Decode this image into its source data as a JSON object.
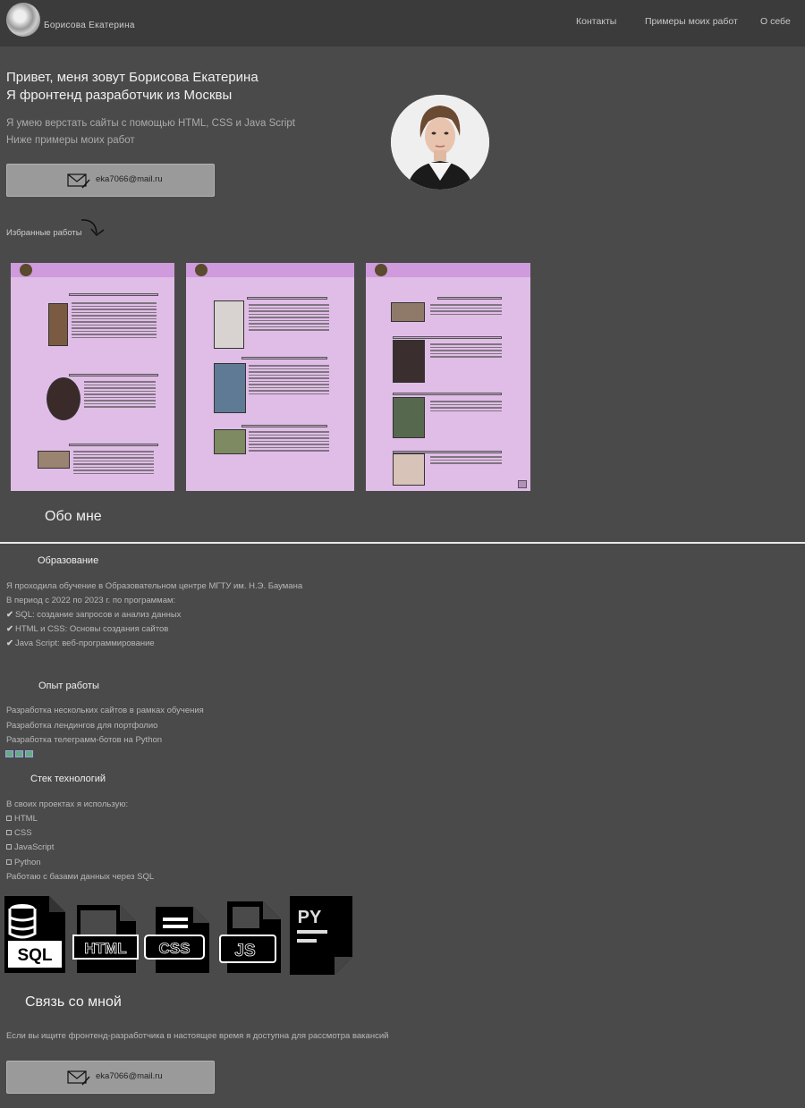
{
  "header": {
    "brand": "Борисова Екатерина",
    "nav": [
      "Контакты",
      "Примеры моих работ",
      "О себе"
    ]
  },
  "hero": {
    "line1": "Привет, меня зовут Борисова Екатерина",
    "line2": "Я фронтенд разработчик из Москвы",
    "intro1": "Я умею верстать сайты с помощью HTML, CSS и Java Script",
    "intro2": "Ниже примеры моих работ",
    "email": "eka7066@mail.ru"
  },
  "works": {
    "label": "Избранные работы"
  },
  "about": {
    "title": "Обо мне",
    "education": {
      "title": "Образование",
      "lines": [
        "Я проходила обучение в    Образовательном центре МГТУ им. Н.Э. Баумана",
        "В период с 2022 по 2023 г. по программам:"
      ],
      "programs": [
        "SQL: создание запросов и анализ данных",
        "HTML и CSS: Основы создания сайтов",
        "Java Script: веб-программирование"
      ]
    },
    "experience": {
      "title": "Опыт работы",
      "items": [
        "Разработка нескольких сайтов в рамках обучения",
        "Разработка лендингов для портфолио",
        "Разработка телеграмм-ботов на Python"
      ]
    },
    "stack": {
      "title": "Стек технологий",
      "intro": "В своих проектах я использую:",
      "items": [
        "HTML",
        "CSS",
        "JavaScript",
        "Python"
      ],
      "outro": "Работаю с базами данных через SQL"
    }
  },
  "tech_icons": [
    {
      "label": "SQL",
      "icon": "sql-file-icon"
    },
    {
      "label": "HTML",
      "icon": "html-file-icon"
    },
    {
      "label": "CSS",
      "icon": "css-file-icon"
    },
    {
      "label": "JS",
      "icon": "js-file-icon"
    },
    {
      "label": "PY",
      "icon": "python-file-icon"
    }
  ],
  "contact": {
    "title": "Связь со мной",
    "text": "Если вы ищите фронтенд-разработчика в настоящее время я доступна для рассмотра вакансий",
    "email": "eka7066@mail.ru"
  }
}
